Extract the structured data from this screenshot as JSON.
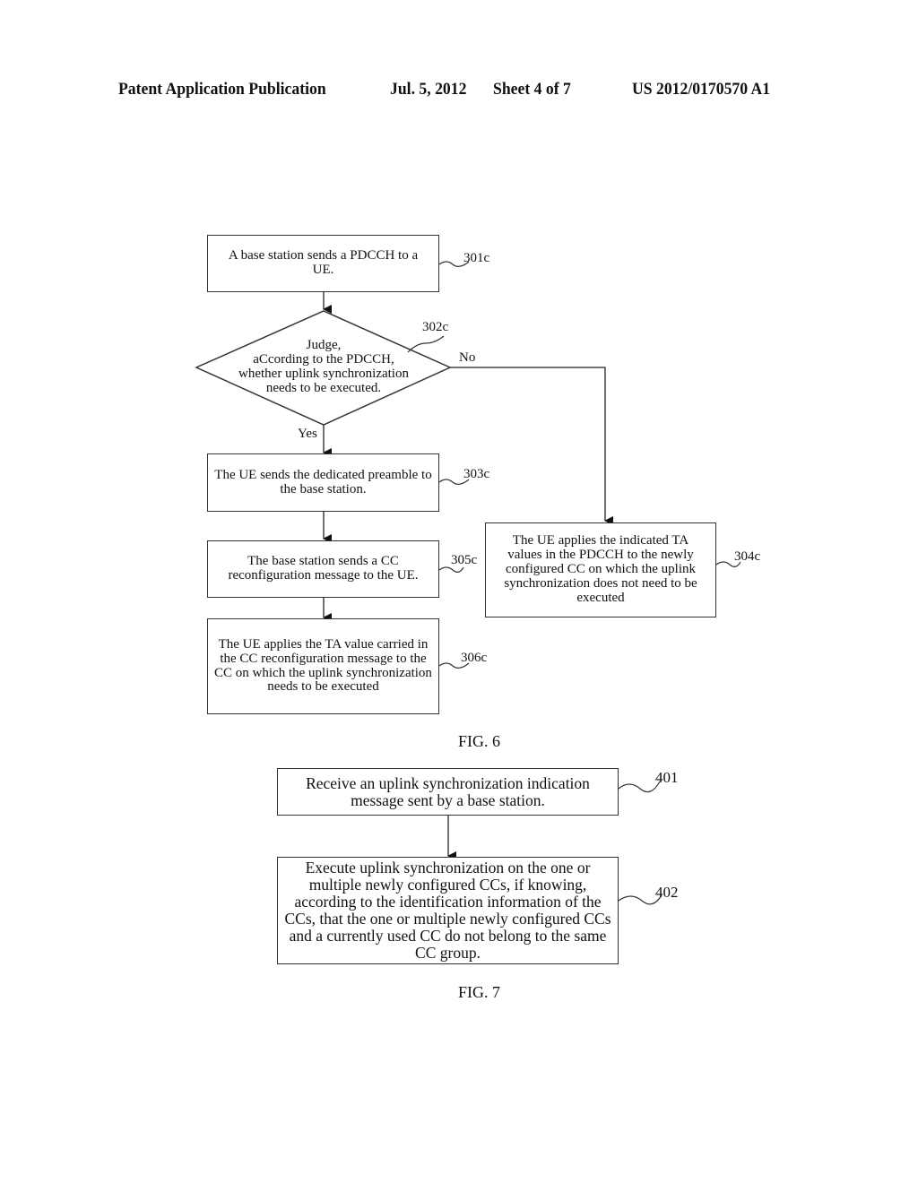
{
  "header": {
    "publication": "Patent Application Publication",
    "date": "Jul. 5, 2012",
    "sheet": "Sheet 4 of 7",
    "number": "US 2012/0170570 A1"
  },
  "fig6": {
    "caption": "FIG. 6",
    "steps": {
      "s301c": {
        "ref": "301c",
        "text": "A base station sends a PDCCH to a UE."
      },
      "s302c": {
        "ref": "302c",
        "lines": [
          "Judge,",
          "aCcording to the PDCCH,",
          "whether uplink synchronization",
          "needs to be executed."
        ]
      },
      "s303c": {
        "ref": "303c",
        "text": "The UE sends the dedicated preamble to the base station."
      },
      "s304c": {
        "ref": "304c",
        "text": "The UE applies the indicated TA values in the PDCCH to the newly configured CC on which the uplink synchronization does not need to be executed"
      },
      "s305c": {
        "ref": "305c",
        "text": "The base station sends a CC reconfiguration message to the UE."
      },
      "s306c": {
        "ref": "306c",
        "text": "The UE applies the TA value carried in the CC reconfiguration message to the CC on which the uplink synchronization needs to be executed"
      }
    },
    "branches": {
      "yes": "Yes",
      "no": "No"
    }
  },
  "fig7": {
    "caption": "FIG. 7",
    "steps": {
      "s401": {
        "ref": "401",
        "text": "Receive an uplink synchronization indication message sent by a base station."
      },
      "s402": {
        "ref": "402",
        "text": "Execute uplink synchronization on the one or multiple newly configured CCs, if knowing, according to the identification information of the CCs, that the one or multiple newly configured CCs and a currently used CC do not belong to the same CC group."
      }
    }
  }
}
